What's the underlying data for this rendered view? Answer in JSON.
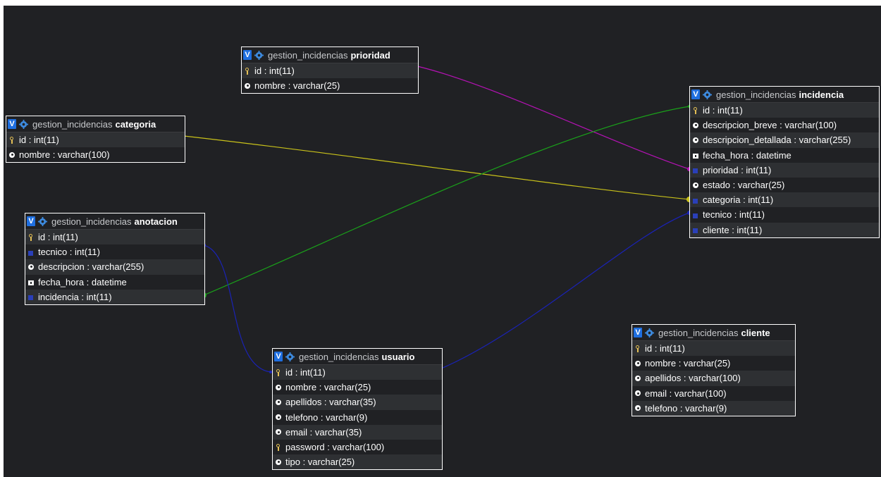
{
  "colors": {
    "canvas_bg": "#202124",
    "link_prioridad": "#b512b5",
    "link_categoria": "#c9c21a",
    "link_incidencia": "#1aa11a",
    "link_usuario": "#1a22b5"
  },
  "tables": [
    {
      "id": "prioridad",
      "db": "gestion_incidencias",
      "name": "prioridad",
      "fields": [
        {
          "icon": "key-icon",
          "text": "id : int(11)"
        },
        {
          "icon": "string-icon",
          "text": "nombre : varchar(25)"
        }
      ]
    },
    {
      "id": "categoria",
      "db": "gestion_incidencias",
      "name": "categoria",
      "fields": [
        {
          "icon": "key-icon",
          "text": "id : int(11)"
        },
        {
          "icon": "string-icon",
          "text": "nombre : varchar(100)"
        }
      ]
    },
    {
      "id": "anotacion",
      "db": "gestion_incidencias",
      "name": "anotacion",
      "fields": [
        {
          "icon": "key-icon",
          "text": "id : int(11)"
        },
        {
          "icon": "foreign-key-icon",
          "text": "tecnico : int(11)"
        },
        {
          "icon": "string-icon",
          "text": "descripcion : varchar(255)"
        },
        {
          "icon": "datetime-icon",
          "text": "fecha_hora : datetime"
        },
        {
          "icon": "foreign-key-icon",
          "text": "incidencia : int(11)"
        }
      ]
    },
    {
      "id": "usuario",
      "db": "gestion_incidencias",
      "name": "usuario",
      "fields": [
        {
          "icon": "key-icon",
          "text": "id : int(11)"
        },
        {
          "icon": "string-icon",
          "text": "nombre : varchar(25)"
        },
        {
          "icon": "string-icon",
          "text": "apellidos : varchar(35)"
        },
        {
          "icon": "string-icon",
          "text": "telefono : varchar(9)"
        },
        {
          "icon": "string-icon",
          "text": "email : varchar(35)"
        },
        {
          "icon": "key-icon",
          "text": "password : varchar(100)"
        },
        {
          "icon": "string-icon",
          "text": "tipo : varchar(25)"
        }
      ]
    },
    {
      "id": "incidencia",
      "db": "gestion_incidencias",
      "name": "incidencia",
      "fields": [
        {
          "icon": "key-icon",
          "text": "id : int(11)"
        },
        {
          "icon": "string-icon",
          "text": "descripcion_breve : varchar(100)"
        },
        {
          "icon": "string-icon",
          "text": "descripcion_detallada : varchar(255)"
        },
        {
          "icon": "datetime-icon",
          "text": "fecha_hora : datetime"
        },
        {
          "icon": "foreign-key-icon",
          "text": "prioridad : int(11)"
        },
        {
          "icon": "string-icon",
          "text": "estado : varchar(25)"
        },
        {
          "icon": "foreign-key-icon",
          "text": "categoria : int(11)"
        },
        {
          "icon": "foreign-key-icon",
          "text": "tecnico : int(11)"
        },
        {
          "icon": "foreign-key-icon",
          "text": "cliente : int(11)"
        }
      ]
    },
    {
      "id": "cliente",
      "db": "gestion_incidencias",
      "name": "cliente",
      "fields": [
        {
          "icon": "key-icon",
          "text": "id : int(11)"
        },
        {
          "icon": "string-icon",
          "text": "nombre : varchar(25)"
        },
        {
          "icon": "string-icon",
          "text": "apellidos : varchar(100)"
        },
        {
          "icon": "string-icon",
          "text": "email : varchar(100)"
        },
        {
          "icon": "string-icon",
          "text": "telefono : varchar(9)"
        }
      ]
    }
  ],
  "relations": [
    {
      "from": "incidencia.prioridad",
      "to": "prioridad.id",
      "color_key": "link_prioridad"
    },
    {
      "from": "incidencia.categoria",
      "to": "categoria.id",
      "color_key": "link_categoria"
    },
    {
      "from": "anotacion.incidencia",
      "to": "incidencia.id",
      "color_key": "link_incidencia"
    },
    {
      "from": "incidencia.tecnico",
      "to": "usuario.id",
      "color_key": "link_usuario"
    },
    {
      "from": "anotacion.tecnico",
      "to": "usuario.id",
      "color_key": "link_usuario"
    }
  ]
}
